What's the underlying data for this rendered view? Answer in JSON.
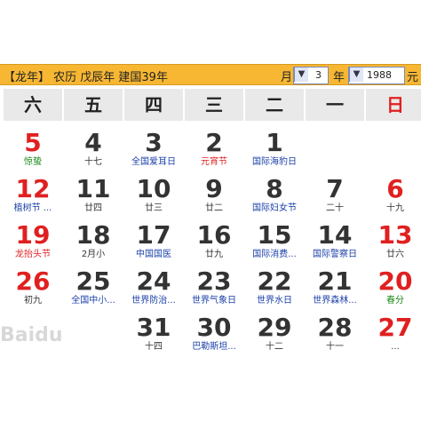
{
  "topbar": {
    "left_text": "【龙年】 农历 戊辰年 建国39年",
    "month_label": "月",
    "month_value": "3",
    "year_label": "年",
    "year_value": "1988",
    "yuan_label": "元"
  },
  "weekdays": [
    "六",
    "五",
    "四",
    "三",
    "二",
    "一",
    "日"
  ],
  "rows": [
    [
      {
        "num": "5",
        "sub": "惊蛰",
        "num_color": "red",
        "sub_color": "green"
      },
      {
        "num": "4",
        "sub": "十七",
        "num_color": "",
        "sub_color": ""
      },
      {
        "num": "3",
        "sub": "全国爱耳日",
        "num_color": "",
        "sub_color": "blue"
      },
      {
        "num": "2",
        "sub": "元宵节",
        "num_color": "",
        "sub_color": "red"
      },
      {
        "num": "1",
        "sub": "国际海豹日",
        "num_color": "",
        "sub_color": "blue"
      },
      {
        "num": "",
        "sub": "",
        "num_color": "",
        "sub_color": ""
      },
      {
        "num": "",
        "sub": "",
        "num_color": "",
        "sub_color": ""
      }
    ],
    [
      {
        "num": "12",
        "sub": "植树节 ...",
        "num_color": "red",
        "sub_color": "blue"
      },
      {
        "num": "11",
        "sub": "廿四",
        "num_color": "",
        "sub_color": ""
      },
      {
        "num": "10",
        "sub": "廿三",
        "num_color": "",
        "sub_color": ""
      },
      {
        "num": "9",
        "sub": "廿二",
        "num_color": "",
        "sub_color": ""
      },
      {
        "num": "8",
        "sub": "国际妇女节",
        "num_color": "",
        "sub_color": "blue"
      },
      {
        "num": "7",
        "sub": "二十",
        "num_color": "",
        "sub_color": ""
      },
      {
        "num": "6",
        "sub": "十九",
        "num_color": "red",
        "sub_color": ""
      }
    ],
    [
      {
        "num": "19",
        "sub": "龙抬头节",
        "num_color": "red",
        "sub_color": "red"
      },
      {
        "num": "18",
        "sub": "2月小",
        "num_color": "",
        "sub_color": ""
      },
      {
        "num": "17",
        "sub": "中国国医",
        "num_color": "",
        "sub_color": "blue"
      },
      {
        "num": "16",
        "sub": "廿九",
        "num_color": "",
        "sub_color": ""
      },
      {
        "num": "15",
        "sub": "国际消费...",
        "num_color": "",
        "sub_color": "blue"
      },
      {
        "num": "14",
        "sub": "国际警察日",
        "num_color": "",
        "sub_color": "blue"
      },
      {
        "num": "13",
        "sub": "廿六",
        "num_color": "red",
        "sub_color": ""
      }
    ],
    [
      {
        "num": "26",
        "sub": "初九",
        "num_color": "red",
        "sub_color": ""
      },
      {
        "num": "25",
        "sub": "全国中小...",
        "num_color": "",
        "sub_color": "blue"
      },
      {
        "num": "24",
        "sub": "世界防治...",
        "num_color": "",
        "sub_color": "blue"
      },
      {
        "num": "23",
        "sub": "世界气象日",
        "num_color": "",
        "sub_color": "blue"
      },
      {
        "num": "22",
        "sub": "世界水日",
        "num_color": "",
        "sub_color": "blue"
      },
      {
        "num": "21",
        "sub": "世界森林...",
        "num_color": "",
        "sub_color": "blue"
      },
      {
        "num": "20",
        "sub": "春分",
        "num_color": "red",
        "sub_color": "green"
      }
    ],
    [
      {
        "num": "",
        "sub": "",
        "num_color": "",
        "sub_color": ""
      },
      {
        "num": "",
        "sub": "",
        "num_color": "",
        "sub_color": ""
      },
      {
        "num": "31",
        "sub": "十四",
        "num_color": "",
        "sub_color": ""
      },
      {
        "num": "30",
        "sub": "巴勒斯坦...",
        "num_color": "",
        "sub_color": "blue"
      },
      {
        "num": "29",
        "sub": "十二",
        "num_color": "",
        "sub_color": ""
      },
      {
        "num": "28",
        "sub": "十一",
        "num_color": "",
        "sub_color": ""
      },
      {
        "num": "27",
        "sub": "...",
        "num_color": "red",
        "sub_color": ""
      }
    ]
  ],
  "watermark": "Baidu"
}
